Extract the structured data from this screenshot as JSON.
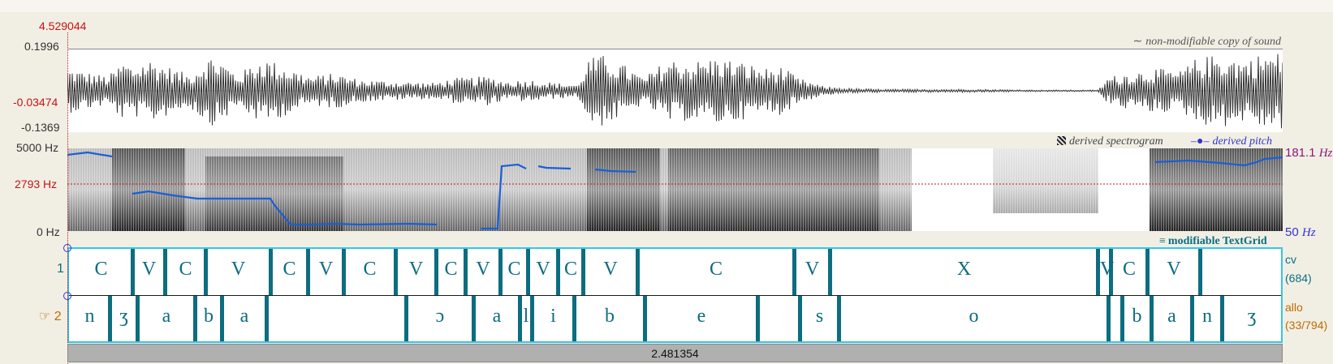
{
  "cursor_time": "4.529044",
  "waveform": {
    "max_label": "0.1996",
    "cursor_value": "-0.03474",
    "min_label": "-0.1369",
    "caption_icon": "tilde-icon",
    "caption": "non-modifiable copy of sound"
  },
  "spectrogram": {
    "top_label": "5000 Hz",
    "cursor_label": "2793 Hz",
    "bottom_label": "0 Hz",
    "caption_icon": "spectrogram-swatch-icon",
    "caption_spectrogram": "derived spectrogram",
    "caption_pitch_icon": "pitch-line-icon",
    "caption_pitch": "derived pitch",
    "pitch_top": "181.1",
    "pitch_bottom": "50",
    "pitch_unit": "Hz",
    "pitch_color": "#1a5fd6"
  },
  "textgrid": {
    "caption_icon": "textgrid-icon",
    "caption": "modifiable TextGrid",
    "tiers": [
      {
        "number": "1",
        "name": "cv",
        "count": "(684)",
        "color": "#0d6d80",
        "segments": [
          "C",
          "V",
          "C",
          "V",
          "C",
          "V",
          "C",
          "V",
          "C",
          "V",
          "C",
          "V",
          "C",
          "V",
          "C",
          "V",
          "X",
          "V",
          "C",
          "V"
        ]
      },
      {
        "number": "2",
        "pointer_icon": "pointing-hand-icon",
        "name": "allo",
        "count": "(33/794)",
        "color": "#c06a00",
        "segments": [
          "n",
          "ʒ",
          "a",
          "b",
          "a",
          "ɔ",
          "a",
          "l",
          "i",
          "b",
          "e",
          "s",
          "o",
          "b",
          "a",
          "n",
          "ʒ"
        ]
      }
    ]
  },
  "bottom_bar": {
    "duration": "2.481354"
  },
  "colors": {
    "accent_red": "#cc1111",
    "textgrid_border": "#33c7e8",
    "boundary": "#0d6d80",
    "background": "#f1efe4"
  }
}
